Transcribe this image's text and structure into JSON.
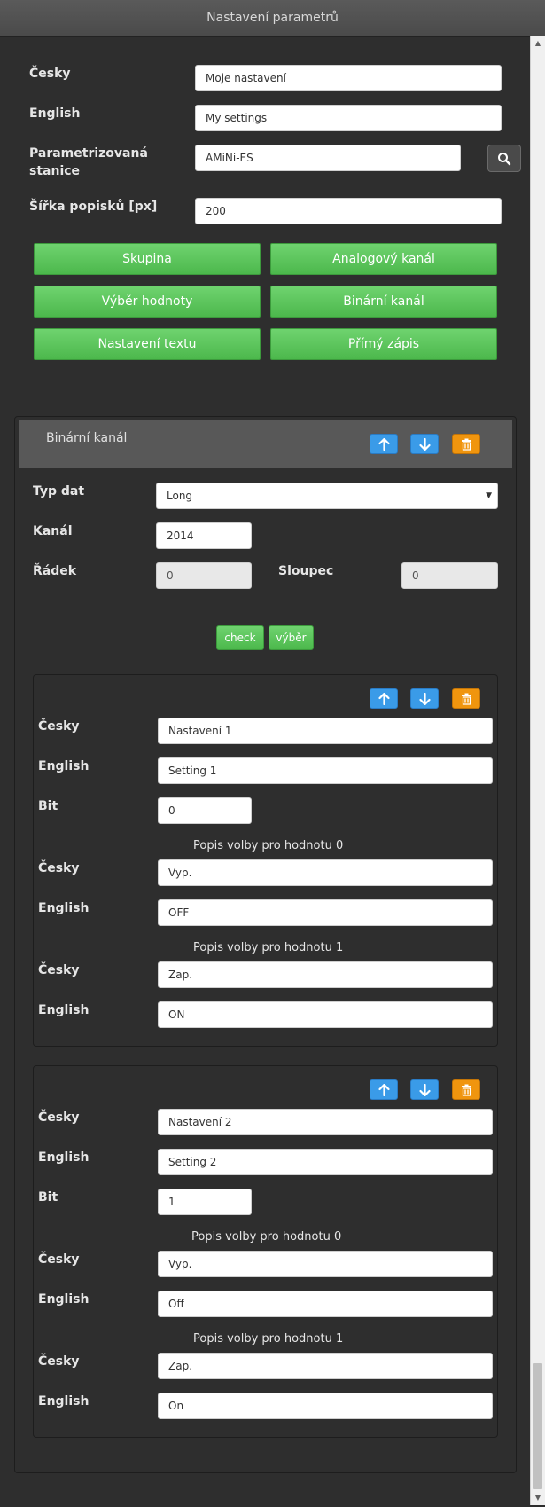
{
  "window": {
    "title": "Nastavení parametrů"
  },
  "header_form": {
    "cesky_label": "Česky",
    "cesky_value": "Moje nastavení",
    "english_label": "English",
    "english_value": "My settings",
    "station_label": "Parametrizovaná stanice",
    "station_value": "AMiNi-ES",
    "width_label": "Šířka popisků [px]",
    "width_value": "200"
  },
  "add_buttons": {
    "group": "Skupina",
    "analog": "Analogový kanál",
    "value_select": "Výběr hodnoty",
    "binary": "Binární kanál",
    "text_setting": "Nastavení textu",
    "direct_write": "Přímý zápis"
  },
  "binary_channel": {
    "title": "Binární kanál",
    "data_type_label": "Typ dat",
    "data_type_value": "Long",
    "channel_label": "Kanál",
    "channel_value": "2014",
    "row_label": "Řádek",
    "row_value": "0",
    "column_label": "Sloupec",
    "column_value": "0",
    "check_label": "check",
    "select_label": "výběr"
  },
  "items": [
    {
      "cesky_label": "Česky",
      "cesky_value": "Nastavení 1",
      "english_label": "English",
      "english_value": "Setting 1",
      "bit_label": "Bit",
      "bit_value": "0",
      "caption0": "Popis volby pro hodnotu 0",
      "v0_cesky_label": "Česky",
      "v0_cesky_value": "Vyp.",
      "v0_english_label": "English",
      "v0_english_value": "OFF",
      "caption1": "Popis volby pro hodnotu 1",
      "v1_cesky_label": "Česky",
      "v1_cesky_value": "Zap.",
      "v1_english_label": "English",
      "v1_english_value": "ON"
    },
    {
      "cesky_label": "Česky",
      "cesky_value": "Nastavení 2",
      "english_label": "English",
      "english_value": "Setting 2",
      "bit_label": "Bit",
      "bit_value": "1",
      "caption0": "Popis volby pro hodnotu 0",
      "v0_cesky_label": "Česky",
      "v0_cesky_value": "Vyp.",
      "v0_english_label": "English",
      "v0_english_value": "Off",
      "caption1": "Popis volby pro hodnotu 1",
      "v1_cesky_label": "Česky",
      "v1_cesky_value": "Zap.",
      "v1_english_label": "English",
      "v1_english_value": "On"
    }
  ],
  "icons": {
    "move_up": "arrow-up-icon",
    "move_down": "arrow-down-icon",
    "delete": "trash-icon",
    "search": "search-icon"
  },
  "colors": {
    "green_button": "#5cc55c",
    "blue_button": "#3a9be8",
    "orange_button": "#f0950e",
    "background": "#2e2e2e"
  }
}
